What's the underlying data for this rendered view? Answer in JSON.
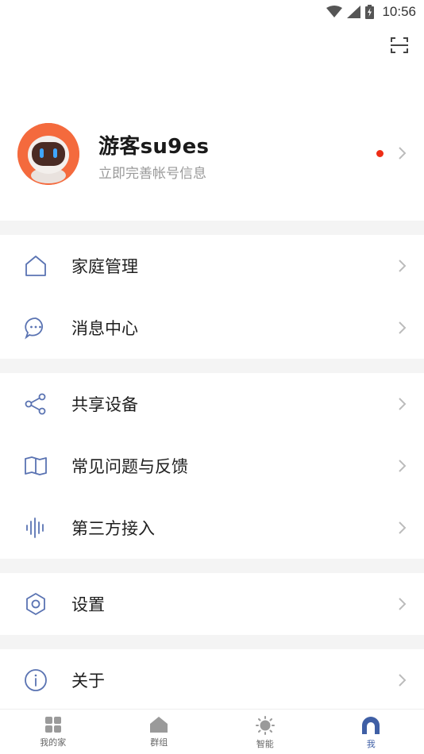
{
  "status_bar": {
    "time": "10:56",
    "icons": [
      "wifi-icon",
      "cellular-signal-icon",
      "battery-icon"
    ]
  },
  "header": {
    "scan_icon": "scan-icon"
  },
  "profile": {
    "name": "游客su9es",
    "subtitle": "立即完善帐号信息",
    "has_notification_dot": true,
    "avatar_icon": "robot-avatar"
  },
  "menu": {
    "group1": [
      {
        "label": "家庭管理",
        "icon": "home-icon"
      },
      {
        "label": "消息中心",
        "icon": "message-icon"
      }
    ],
    "group2": [
      {
        "label": "共享设备",
        "icon": "share-icon"
      },
      {
        "label": "常见问题与反馈",
        "icon": "book-icon"
      },
      {
        "label": "第三方接入",
        "icon": "voice-wave-icon"
      }
    ],
    "group3": [
      {
        "label": "设置",
        "icon": "settings-hex-icon"
      }
    ],
    "group4": [
      {
        "label": "关于",
        "icon": "info-icon"
      }
    ]
  },
  "bottom_nav": [
    {
      "label": "我的家",
      "icon": "grid-icon",
      "active": false
    },
    {
      "label": "群组",
      "icon": "house-icon",
      "active": false
    },
    {
      "label": "智能",
      "icon": "sun-icon",
      "active": false
    },
    {
      "label": "我",
      "icon": "user-icon",
      "active": true
    }
  ],
  "colors": {
    "accent": "#3f5fa5",
    "icon_stroke": "#5a73b2",
    "notification": "#ee2d16",
    "divider": "#f4f4f4",
    "avatar_bg": "#f46a3d"
  }
}
